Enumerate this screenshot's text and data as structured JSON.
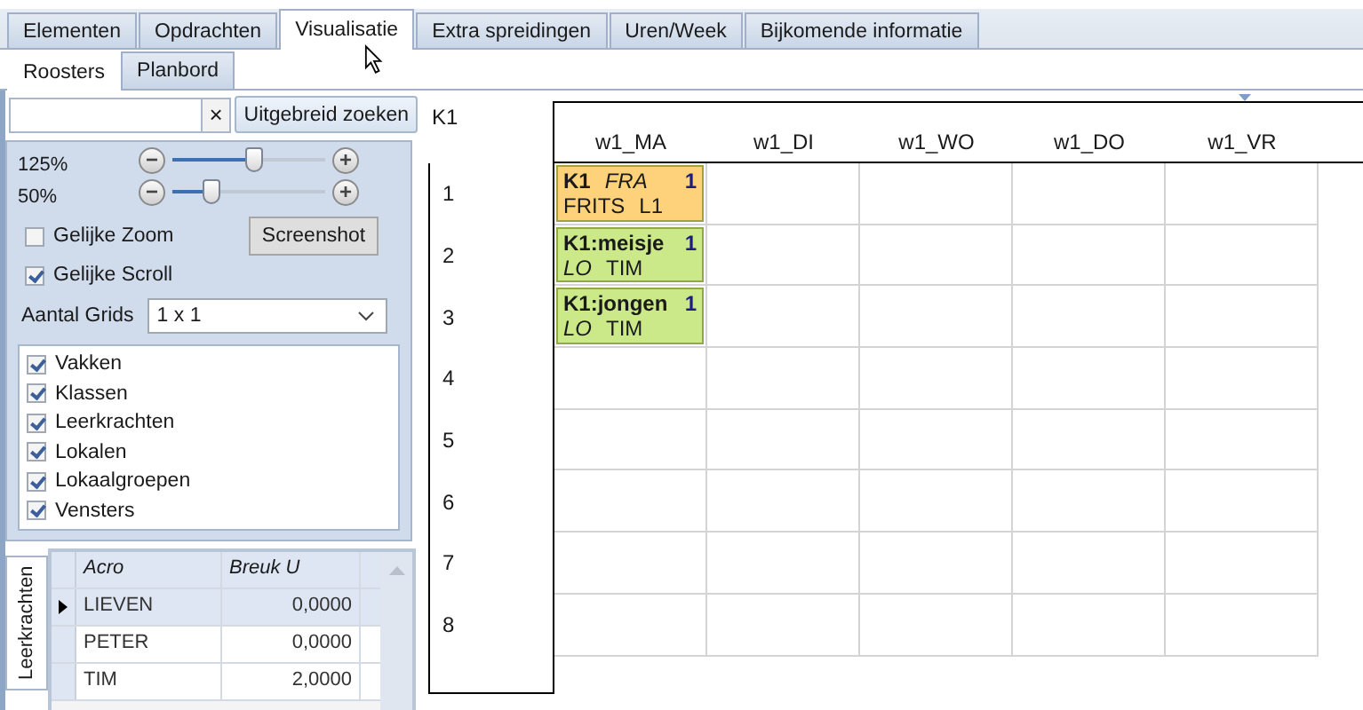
{
  "tabs": [
    {
      "label": "Elementen",
      "selected": false
    },
    {
      "label": "Opdrachten",
      "selected": false
    },
    {
      "label": "Visualisatie",
      "selected": true
    },
    {
      "label": "Extra spreidingen",
      "selected": false
    },
    {
      "label": "Uren/Week",
      "selected": false
    },
    {
      "label": "Bijkomende informatie",
      "selected": false
    }
  ],
  "subtabs": [
    {
      "label": "Roosters",
      "selected": true
    },
    {
      "label": "Planbord",
      "selected": false
    }
  ],
  "search": {
    "clear": "×",
    "button": "Uitgebreid zoeken"
  },
  "zoom_sliders": [
    {
      "reading": "125%",
      "minus": "−",
      "plus": "+",
      "level": 0.54
    },
    {
      "reading": "50%",
      "minus": "−",
      "plus": "+",
      "level": 0.26
    }
  ],
  "options": [
    {
      "label": "Gelijke Zoom",
      "checked": false
    },
    {
      "label": "Gelijke Scroll",
      "checked": true
    }
  ],
  "screenshot_button": "Screenshot",
  "grids": {
    "label": "Aantal Grids",
    "value": "1 x 1"
  },
  "element_types": [
    {
      "label": "Vakken",
      "checked": true
    },
    {
      "label": "Klassen",
      "checked": true
    },
    {
      "label": "Leerkrachten",
      "checked": true
    },
    {
      "label": "Lokalen",
      "checked": true
    },
    {
      "label": "Lokaalgroepen",
      "checked": true
    },
    {
      "label": "Vensters",
      "checked": true
    }
  ],
  "side_tab": "Leerkrachten",
  "table": {
    "columns": [
      "Acro",
      "Breuk U"
    ],
    "rows": [
      {
        "cells": [
          "LIEVEN",
          "0,0000"
        ],
        "selected": true
      },
      {
        "cells": [
          "PETER",
          "0,0000"
        ],
        "selected": false
      },
      {
        "cells": [
          "TIM",
          "2,0000"
        ],
        "selected": false
      }
    ]
  },
  "timetable": {
    "title": "K1",
    "columns": [
      "w1_MA",
      "w1_DI",
      "w1_WO",
      "w1_DO",
      "w1_VR"
    ],
    "rows": [
      {
        "label": "1",
        "cells": [
          {
            "kind": "class-lesson",
            "color": "#fdd27a",
            "group": "K1",
            "subject": "FRA",
            "count": "1",
            "teacher": "FRITS",
            "room": "L1"
          },
          {
            "kind": "empty"
          },
          {
            "kind": "empty"
          },
          {
            "kind": "empty"
          },
          {
            "kind": "empty"
          }
        ]
      },
      {
        "label": "2",
        "cells": [
          {
            "kind": "group-lesson",
            "color": "#cce98a",
            "group": "K1:meisje",
            "count": "1",
            "subject": "LO",
            "teacher": "TIM"
          },
          {
            "kind": "empty"
          },
          {
            "kind": "empty"
          },
          {
            "kind": "empty"
          },
          {
            "kind": "empty"
          }
        ]
      },
      {
        "label": "3",
        "cells": [
          {
            "kind": "group-lesson",
            "color": "#cce98a",
            "group": "K1:jongen",
            "count": "1",
            "subject": "LO",
            "teacher": "TIM"
          },
          {
            "kind": "empty"
          },
          {
            "kind": "empty"
          },
          {
            "kind": "empty"
          },
          {
            "kind": "empty"
          }
        ]
      },
      {
        "label": "4",
        "cells": [
          {
            "kind": "empty"
          },
          {
            "kind": "empty"
          },
          {
            "kind": "empty"
          },
          {
            "kind": "empty"
          },
          {
            "kind": "empty"
          }
        ]
      },
      {
        "label": "5",
        "cells": [
          {
            "kind": "empty"
          },
          {
            "kind": "empty"
          },
          {
            "kind": "empty"
          },
          {
            "kind": "empty"
          },
          {
            "kind": "empty"
          }
        ]
      },
      {
        "label": "6",
        "cells": [
          {
            "kind": "empty"
          },
          {
            "kind": "empty"
          },
          {
            "kind": "empty"
          },
          {
            "kind": "empty"
          },
          {
            "kind": "empty"
          }
        ]
      },
      {
        "label": "7",
        "cells": [
          {
            "kind": "empty"
          },
          {
            "kind": "empty"
          },
          {
            "kind": "empty"
          },
          {
            "kind": "empty"
          },
          {
            "kind": "empty"
          }
        ]
      },
      {
        "label": "8",
        "cells": [
          {
            "kind": "empty"
          },
          {
            "kind": "empty"
          },
          {
            "kind": "empty"
          },
          {
            "kind": "empty"
          },
          {
            "kind": "empty"
          }
        ]
      }
    ]
  }
}
